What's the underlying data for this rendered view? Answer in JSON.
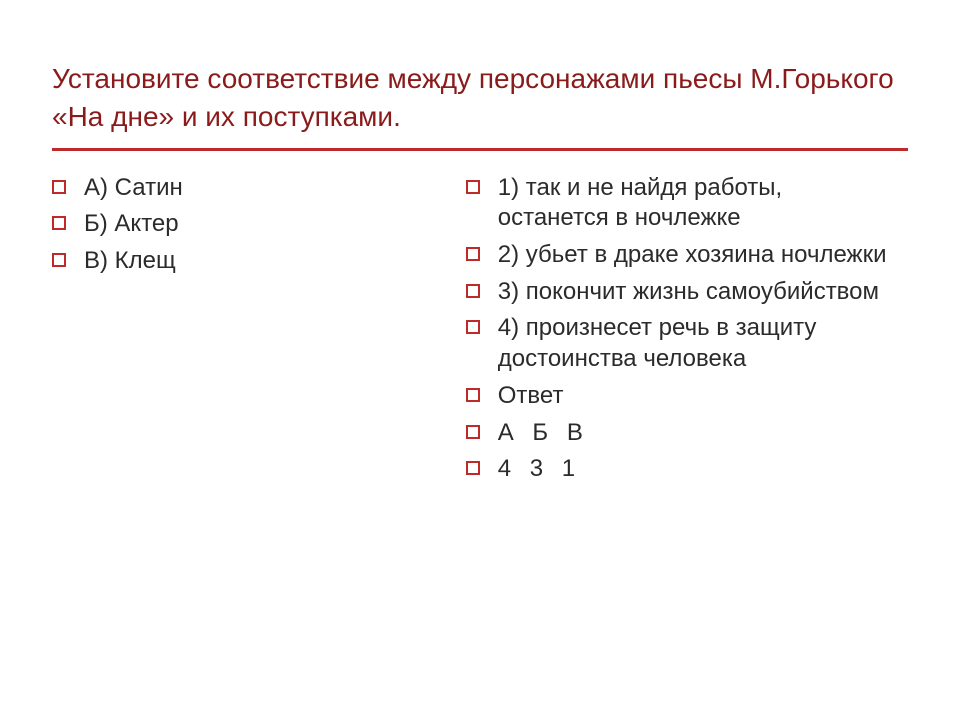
{
  "title": "Установите соответствие между персонажами пьесы М.Горького «На дне» и их поступками.",
  "left": [
    "А) Сатин",
    "Б) Актер",
    "В) Клещ"
  ],
  "right": [
    "1) так и не  найдя работы, останется в ночлежке",
    "2) убьет в драке хозяина ночлежки",
    "3) покончит жизнь самоубийством",
    "4) произнесет речь в защиту достоинства человека",
    "Ответ",
    "А   Б   В",
    "4   3   1"
  ]
}
